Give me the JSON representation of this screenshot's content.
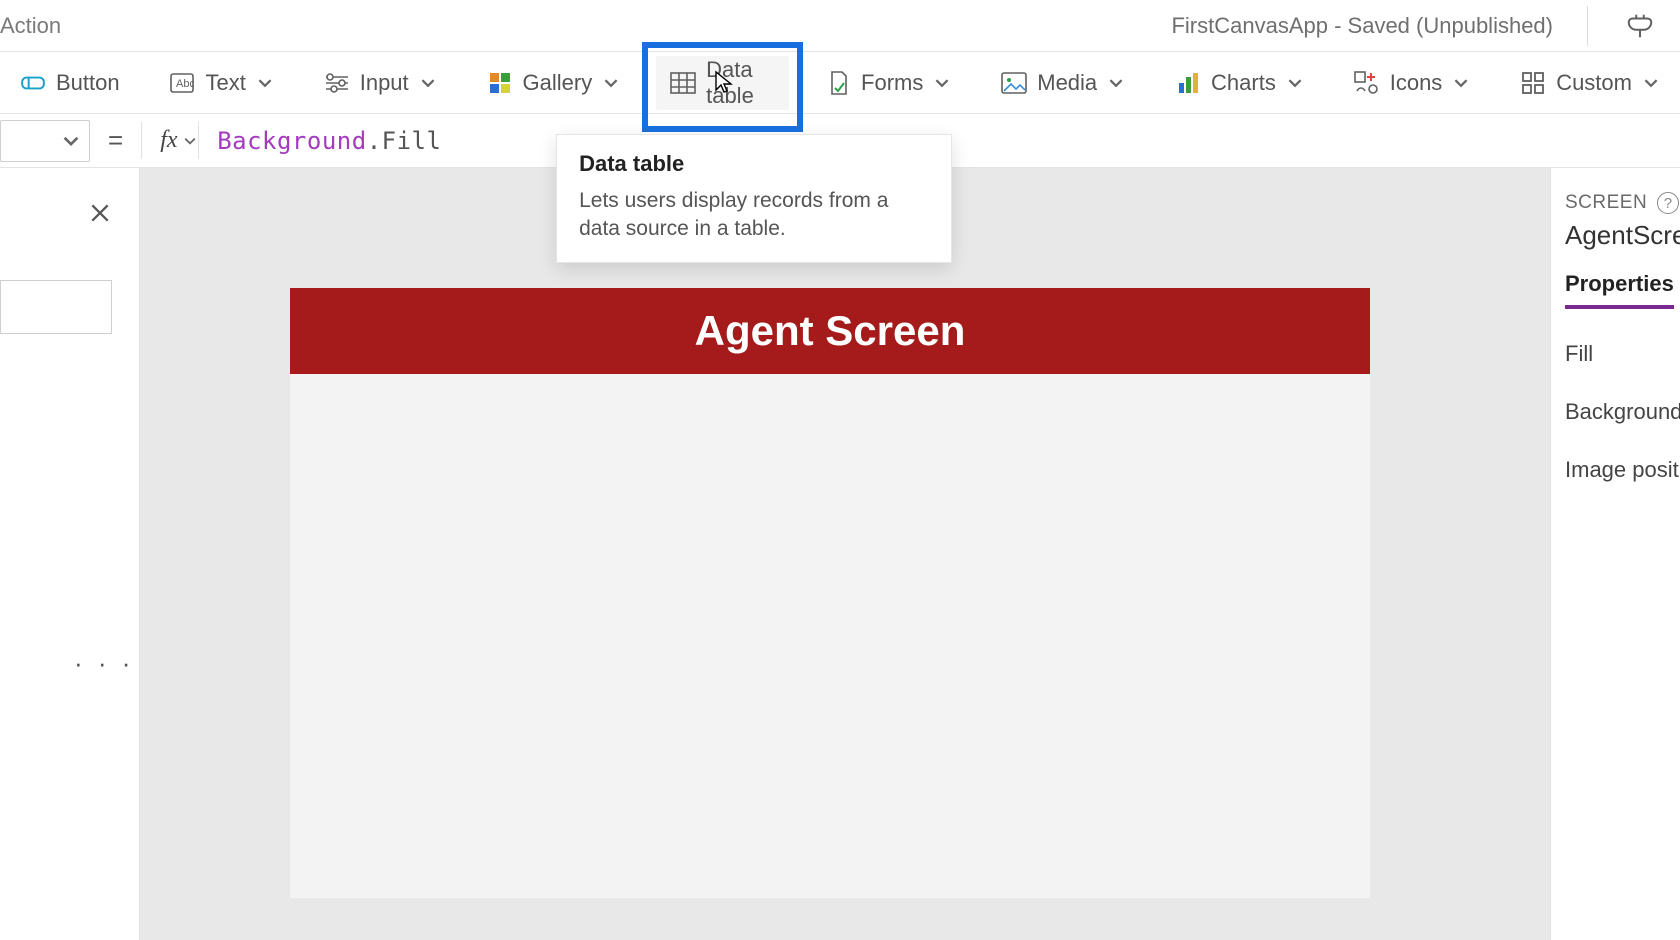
{
  "titlebar": {
    "tab_label": "Action",
    "app_title": "FirstCanvasApp - Saved (Unpublished)"
  },
  "ribbon": {
    "button": "Button",
    "text": "Text",
    "input": "Input",
    "gallery": "Gallery",
    "data_table": "Data table",
    "forms": "Forms",
    "media": "Media",
    "charts": "Charts",
    "icons": "Icons",
    "custom": "Custom"
  },
  "formula": {
    "equals": "=",
    "fx": "fx",
    "identifier": "Background",
    "dot": ".",
    "prop": "Fill"
  },
  "tooltip": {
    "title": "Data table",
    "body": "Lets users display records from a data source in a table."
  },
  "left_panel": {
    "more": "· · ·"
  },
  "canvas": {
    "header": "Agent Screen"
  },
  "right_panel": {
    "section": "SCREEN",
    "help": "?",
    "screen_name": "AgentScree",
    "tab": "Properties",
    "prop_fill": "Fill",
    "prop_bgimage": "Background i",
    "prop_imgpos": "Image positio"
  }
}
